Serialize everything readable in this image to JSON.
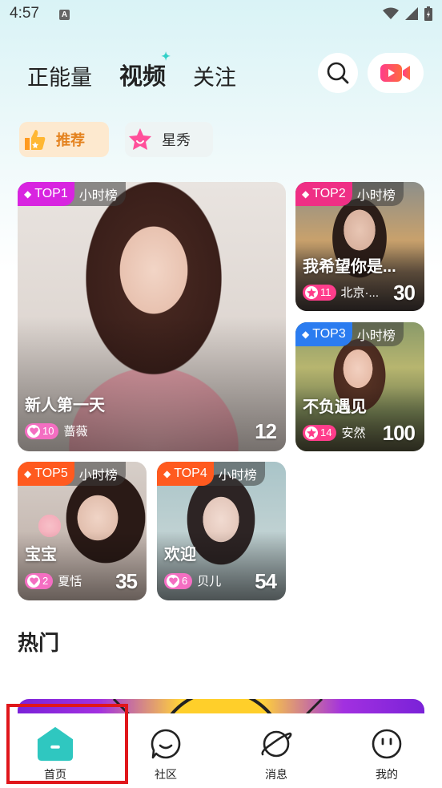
{
  "status_bar": {
    "time": "4:57",
    "notif_icon": "A"
  },
  "header": {
    "tabs": [
      {
        "label": "正能量"
      },
      {
        "label": "视频"
      },
      {
        "label": "关注"
      }
    ]
  },
  "categories": [
    {
      "label": "推荐",
      "icon": "thumbs-up-icon"
    },
    {
      "label": "星秀",
      "icon": "star-icon"
    }
  ],
  "cards": [
    {
      "rank": "TOP1",
      "list": "小时榜",
      "title": "新人第一天",
      "level": "10",
      "name": "蔷薇",
      "count": "12",
      "rank_color": "#d824e0"
    },
    {
      "rank": "TOP2",
      "list": "小时榜",
      "title": "我希望你是...",
      "level": "11",
      "name": "北京·...",
      "count": "30",
      "rank_color": "#ef2f85"
    },
    {
      "rank": "TOP3",
      "list": "小时榜",
      "title": "不负遇见",
      "level": "14",
      "name": "安然",
      "count": "100",
      "rank_color": "#2b7cf0"
    },
    {
      "rank": "TOP5",
      "list": "小时榜",
      "title": "宝宝",
      "level": "2",
      "name": "夏恬",
      "count": "35",
      "rank_color": "#ff5a1f"
    },
    {
      "rank": "TOP4",
      "list": "小时榜",
      "title": "欢迎",
      "level": "6",
      "name": "贝儿",
      "count": "54",
      "rank_color": "#ff5a1f"
    }
  ],
  "section": {
    "title": "热门"
  },
  "bottom_nav": [
    {
      "label": "首页",
      "icon": "home-icon"
    },
    {
      "label": "社区",
      "icon": "community-icon"
    },
    {
      "label": "消息",
      "icon": "planet-icon"
    },
    {
      "label": "我的",
      "icon": "profile-icon"
    }
  ],
  "colors": {
    "accent": "#2fc7c0",
    "highlight_box": "#e0161b",
    "recommend_text": "#e4821e"
  }
}
